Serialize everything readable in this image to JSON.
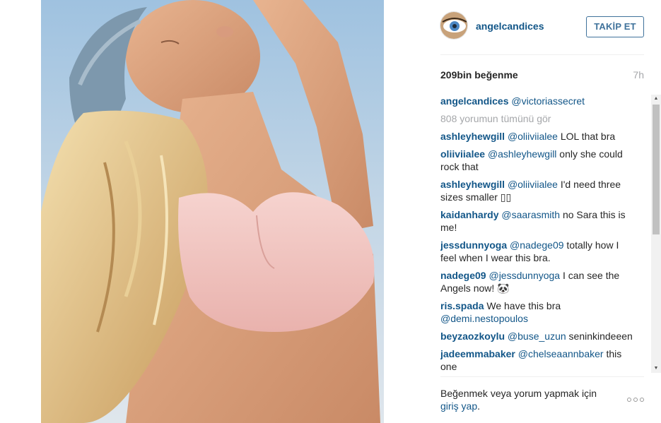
{
  "post": {
    "username": "angelcandices",
    "follow_label": "TAKİP ET",
    "likes": "209bin beğenme",
    "time": "7h"
  },
  "comments": {
    "caption": {
      "user": "angelcandices",
      "text": "@victoriassecret"
    },
    "view_all": "808 yorumun tümünü gör",
    "items": [
      {
        "user": "ashleyhewgill",
        "mention": "@oliiviialee",
        "text": " LOL that bra"
      },
      {
        "user": "oliiviialee",
        "mention": "@ashleyhewgill",
        "text": " only she could rock that"
      },
      {
        "user": "ashleyhewgill",
        "mention": "@oliiviialee",
        "text": " I'd need three sizes smaller ▯▯"
      },
      {
        "user": "kaidanhardy",
        "mention": "@saarasmith",
        "text": " no Sara this is me!"
      },
      {
        "user": "jessdunnyoga",
        "mention": "@nadege09",
        "text": " totally how I feel when I wear this bra."
      },
      {
        "user": "nadege09",
        "mention": "@jessdunnyoga",
        "text": " I can see the Angels now! 🐼"
      },
      {
        "user": "ris.spada",
        "mention": "@demi.nestopoulos",
        "text": "We have this bra"
      },
      {
        "user": "beyzaozkoylu",
        "mention": "@buse_uzun",
        "text": "seninkindeeen"
      },
      {
        "user": "jadeemmabaker",
        "mention": "@chelseaannbaker",
        "text": " this one"
      }
    ]
  },
  "footer": {
    "login_text": "Beğenmek veya yorum yapmak için ",
    "login_link": "giriş yap",
    "login_end": "."
  },
  "icons": {
    "more": "more-options-icon",
    "scroll_up": "scroll-up-arrow-icon",
    "scroll_down": "scroll-down-arrow-icon"
  },
  "colors": {
    "link": "#125688",
    "button": "#3f729b",
    "muted": "#a5a7aa"
  }
}
